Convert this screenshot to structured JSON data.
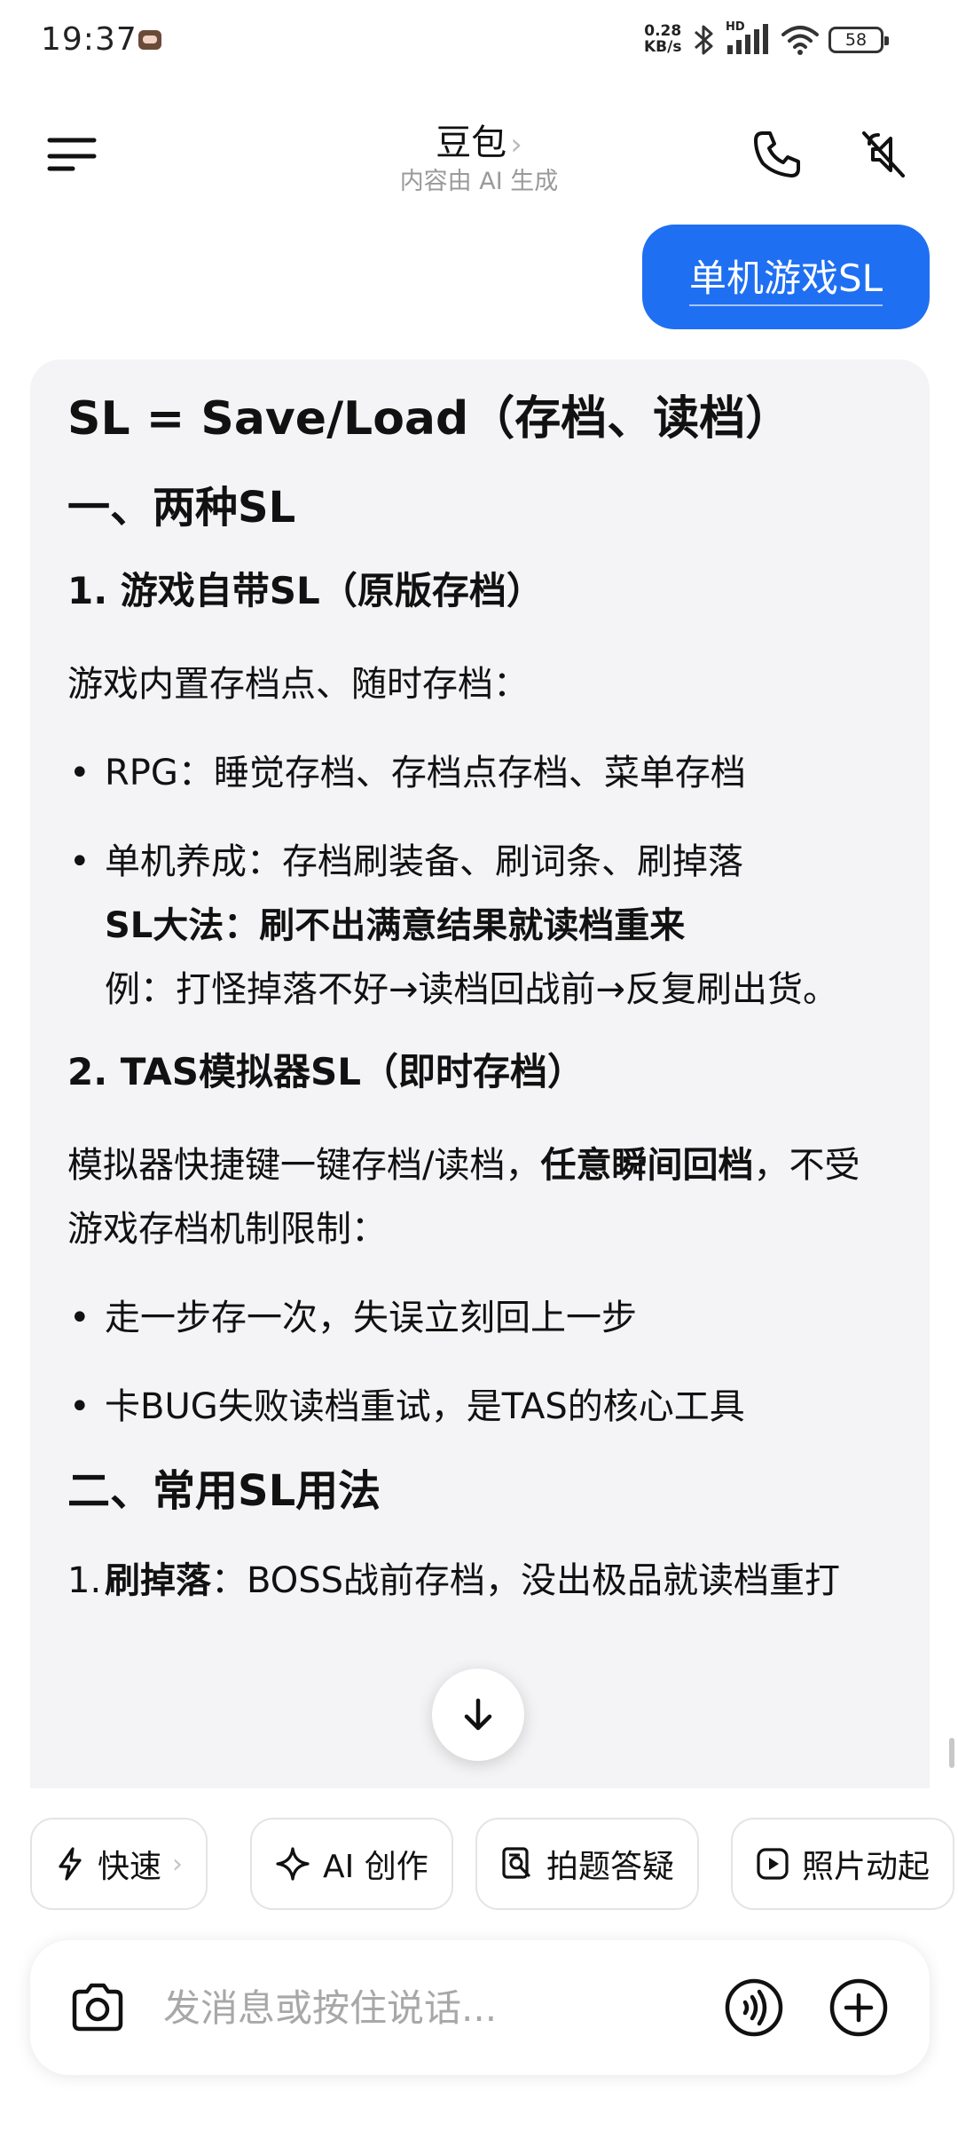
{
  "status_bar": {
    "time": "19:37",
    "net_speed_value": "0.28",
    "net_speed_unit": "KB/s",
    "signal_badge": "HD",
    "battery": "58",
    "icons": [
      "bluetooth-icon",
      "signal-icon",
      "wifi-icon",
      "battery-icon"
    ]
  },
  "header": {
    "title": "豆包",
    "title_chevron": "›",
    "subtitle": "内容由 AI 生成",
    "icons": [
      "menu-icon",
      "phone-icon",
      "speaker-mute-icon"
    ]
  },
  "user_message": "单机游戏SL",
  "answer": {
    "h1": "SL = Save/Load（存档、读档）",
    "s1_title": "一、两种SL",
    "s1_1_title": "1. 游戏自带SL（原版存档）",
    "s1_1_intro": "游戏内置存档点、随时存档：",
    "s1_1_bullet1": "RPG：睡觉存档、存档点存档、菜单存档",
    "s1_1_bullet2_line1": "单机养成：存档刷装备、刷词条、刷掉落",
    "s1_1_bullet2_bold": "SL大法：刷不出满意结果就读档重来",
    "s1_1_bullet2_example": "例：打怪掉落不好→读档回战前→反复刷出货。",
    "s1_2_title": "2. TAS模拟器SL（即时存档）",
    "s1_2_intro_a": "模拟器快捷键一键存档/读档，",
    "s1_2_intro_bold": "任意瞬间回档",
    "s1_2_intro_b": "，不受游戏存档机制限制：",
    "s1_2_bullet1": "走一步存一次，失误立刻回上一步",
    "s1_2_bullet2": "卡BUG失败读档重试，是TAS的核心工具",
    "s2_title": "二、常用SL用法",
    "s2_item1_num": "1.",
    "s2_item1_bold": "刷掉落",
    "s2_item1_text": "：BOSS战前存档，没出极品就读档重打"
  },
  "quick_actions": [
    {
      "label": "快速",
      "icon": "lightning-icon",
      "chevron": "›"
    },
    {
      "label": "AI 创作",
      "icon": "sparkle-icon"
    },
    {
      "label": "拍题答疑",
      "icon": "search-doc-icon"
    },
    {
      "label": "照片动起",
      "icon": "play-icon"
    }
  ],
  "input": {
    "placeholder": "发消息或按住说话...",
    "icons": [
      "camera-icon",
      "voice-call-icon",
      "plus-icon"
    ]
  },
  "colors": {
    "accent": "#1f6ff2",
    "card_bg": "#f4f4f6",
    "muted_text": "#9a9a9a"
  }
}
